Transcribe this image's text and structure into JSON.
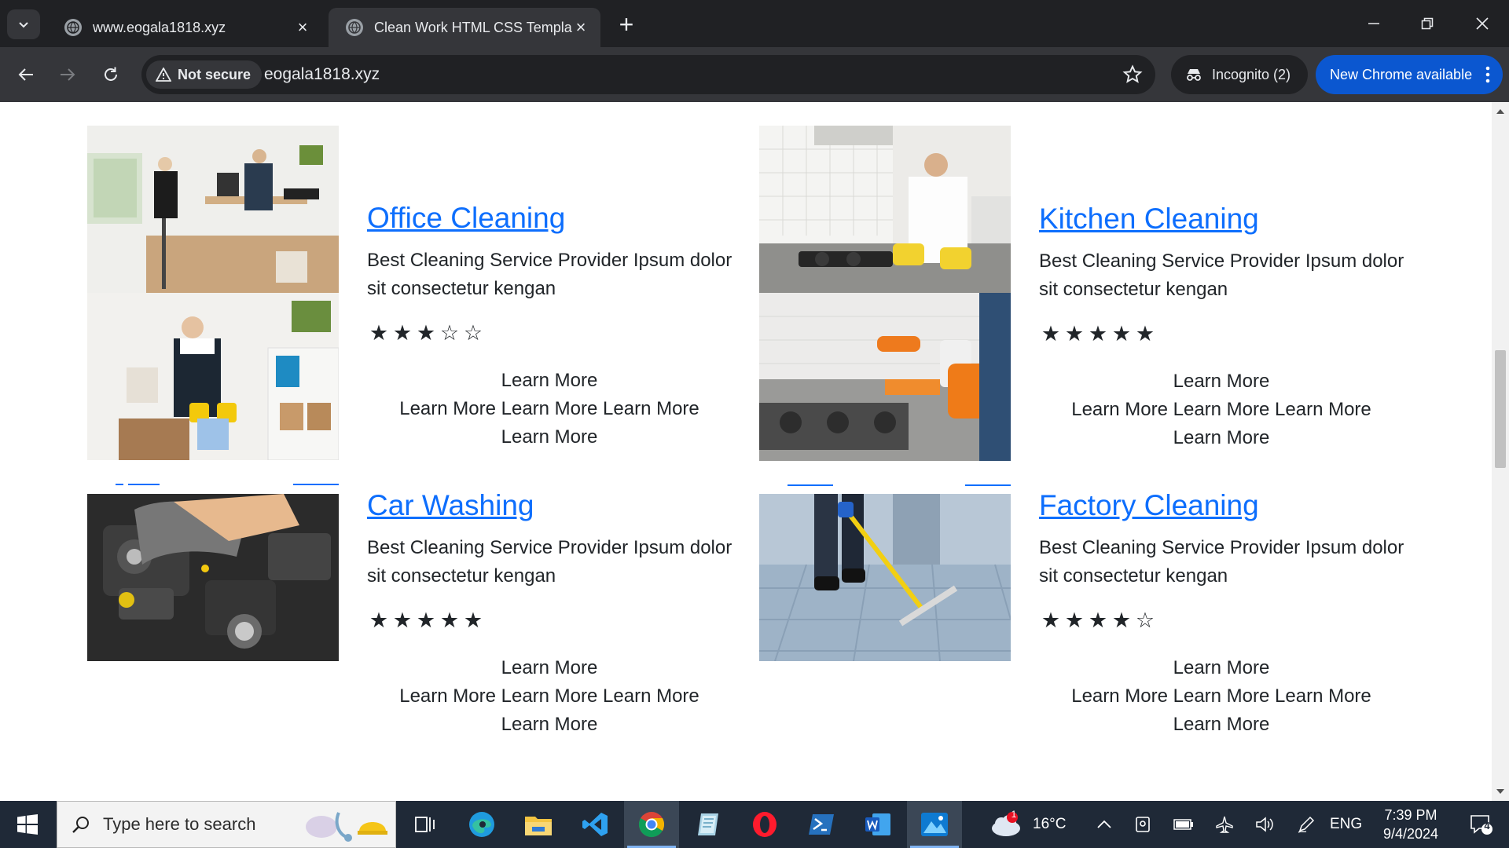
{
  "browser": {
    "tabs": [
      {
        "title": "www.eogala1818.xyz",
        "active": false
      },
      {
        "title": "Clean Work HTML CSS Template",
        "active": true
      }
    ],
    "security_label": "Not secure",
    "url": "eogala1818.xyz",
    "incognito_label": "Incognito (2)",
    "update_label": "New Chrome available"
  },
  "services": [
    {
      "title": "Office Cleaning",
      "description": "Best Cleaning Service Provider Ipsum dolor sit consectetur kengan",
      "rating": 3,
      "rating_max": 5,
      "links": [
        "Learn More",
        "Learn More Learn More Learn More",
        "Learn More"
      ]
    },
    {
      "title": "Kitchen Cleaning",
      "description": "Best Cleaning Service Provider Ipsum dolor sit consectetur kengan",
      "rating": 5,
      "rating_max": 5,
      "links": [
        "Learn More",
        "Learn More Learn More Learn More",
        "Learn More"
      ]
    },
    {
      "title": "Car Washing",
      "description": "Best Cleaning Service Provider Ipsum dolor sit consectetur kengan",
      "rating": 5,
      "rating_max": 5,
      "links": [
        "Learn More",
        "Learn More Learn More Learn More",
        "Learn More"
      ]
    },
    {
      "title": "Factory Cleaning",
      "description": "Best Cleaning Service Provider Ipsum dolor sit consectetur kengan",
      "rating": 4,
      "rating_max": 5,
      "links": [
        "Learn More",
        "Learn More Learn More Learn More",
        "Learn More"
      ]
    }
  ],
  "taskbar": {
    "search_placeholder": "Type here to search",
    "weather": "16°C",
    "weather_badge": "1",
    "language": "ENG",
    "time": "7:39 PM",
    "date": "9/4/2024",
    "notifications": "4",
    "apps": [
      "task-view",
      "edge",
      "file-explorer",
      "vscode",
      "chrome",
      "notes",
      "opera",
      "powershell",
      "word",
      "photos"
    ]
  },
  "colors": {
    "link_blue": "#0d6efd",
    "chrome_dark": "#202124",
    "chrome_toolbar": "#35363a",
    "update_blue": "#0b57d0",
    "taskbar": "#1f2937"
  }
}
